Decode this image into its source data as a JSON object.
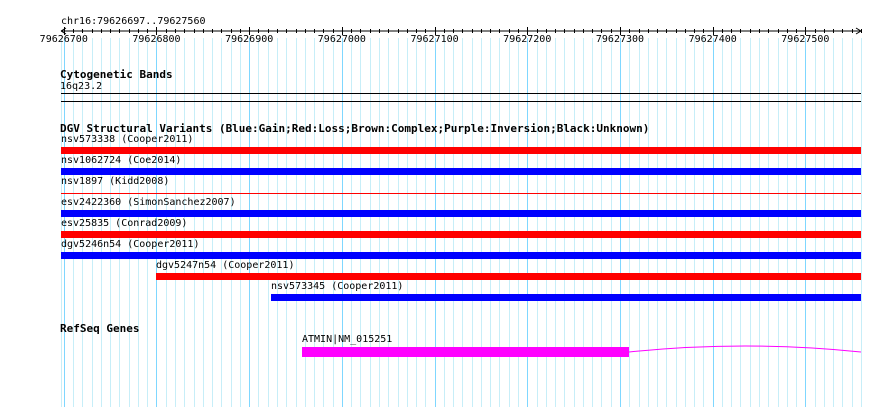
{
  "ruler": {
    "location": "chr16:79626697..79627560",
    "start": 79626697,
    "end": 79627560,
    "ticks": [
      "79626700",
      "79626800",
      "79626900",
      "79627000",
      "79627100",
      "79627200",
      "79627300",
      "79627400",
      "79627500"
    ]
  },
  "cytoband": {
    "title": "Cytogenetic Bands",
    "band": "16q23.2"
  },
  "dgv": {
    "title": "DGV Structural Variants (Blue:Gain;Red:Loss;Brown:Complex;Purple:Inversion;Black:Unknown)",
    "colors": {
      "loss": "#ff0000",
      "gain": "#0000ff"
    },
    "variants": [
      {
        "label": "nsv573338 (Cooper2011)",
        "type": "loss",
        "start": 79626697,
        "end": 79627560
      },
      {
        "label": "nsv1062724 (Coe2014)",
        "type": "gain",
        "start": 79626697,
        "end": 79627560
      },
      {
        "label": "nsv1897 (Kidd2008)",
        "type": "loss",
        "start": 79626697,
        "end": 79627560
      },
      {
        "label": "esv2422360 (SimonSanchez2007)",
        "type": "gain",
        "start": 79626697,
        "end": 79627560
      },
      {
        "label": "esv25835 (Conrad2009)",
        "type": "loss",
        "start": 79626697,
        "end": 79627560
      },
      {
        "label": "dgv5246n54 (Cooper2011)",
        "type": "gain",
        "start": 79626697,
        "end": 79627560
      },
      {
        "label": "dgv5247n54 (Cooper2011)",
        "type": "loss",
        "start": 79626800,
        "end": 79627560
      },
      {
        "label": "nsv573345 (Cooper2011)",
        "type": "gain",
        "start": 79626923,
        "end": 79627560
      }
    ]
  },
  "refseq": {
    "title": "RefSeq Genes",
    "color": "#ff00ff",
    "genes": [
      {
        "label": "ATMIN|NM_015251",
        "block_start": 79626957,
        "block_end": 79627310,
        "intron_end": 79627560
      }
    ]
  }
}
